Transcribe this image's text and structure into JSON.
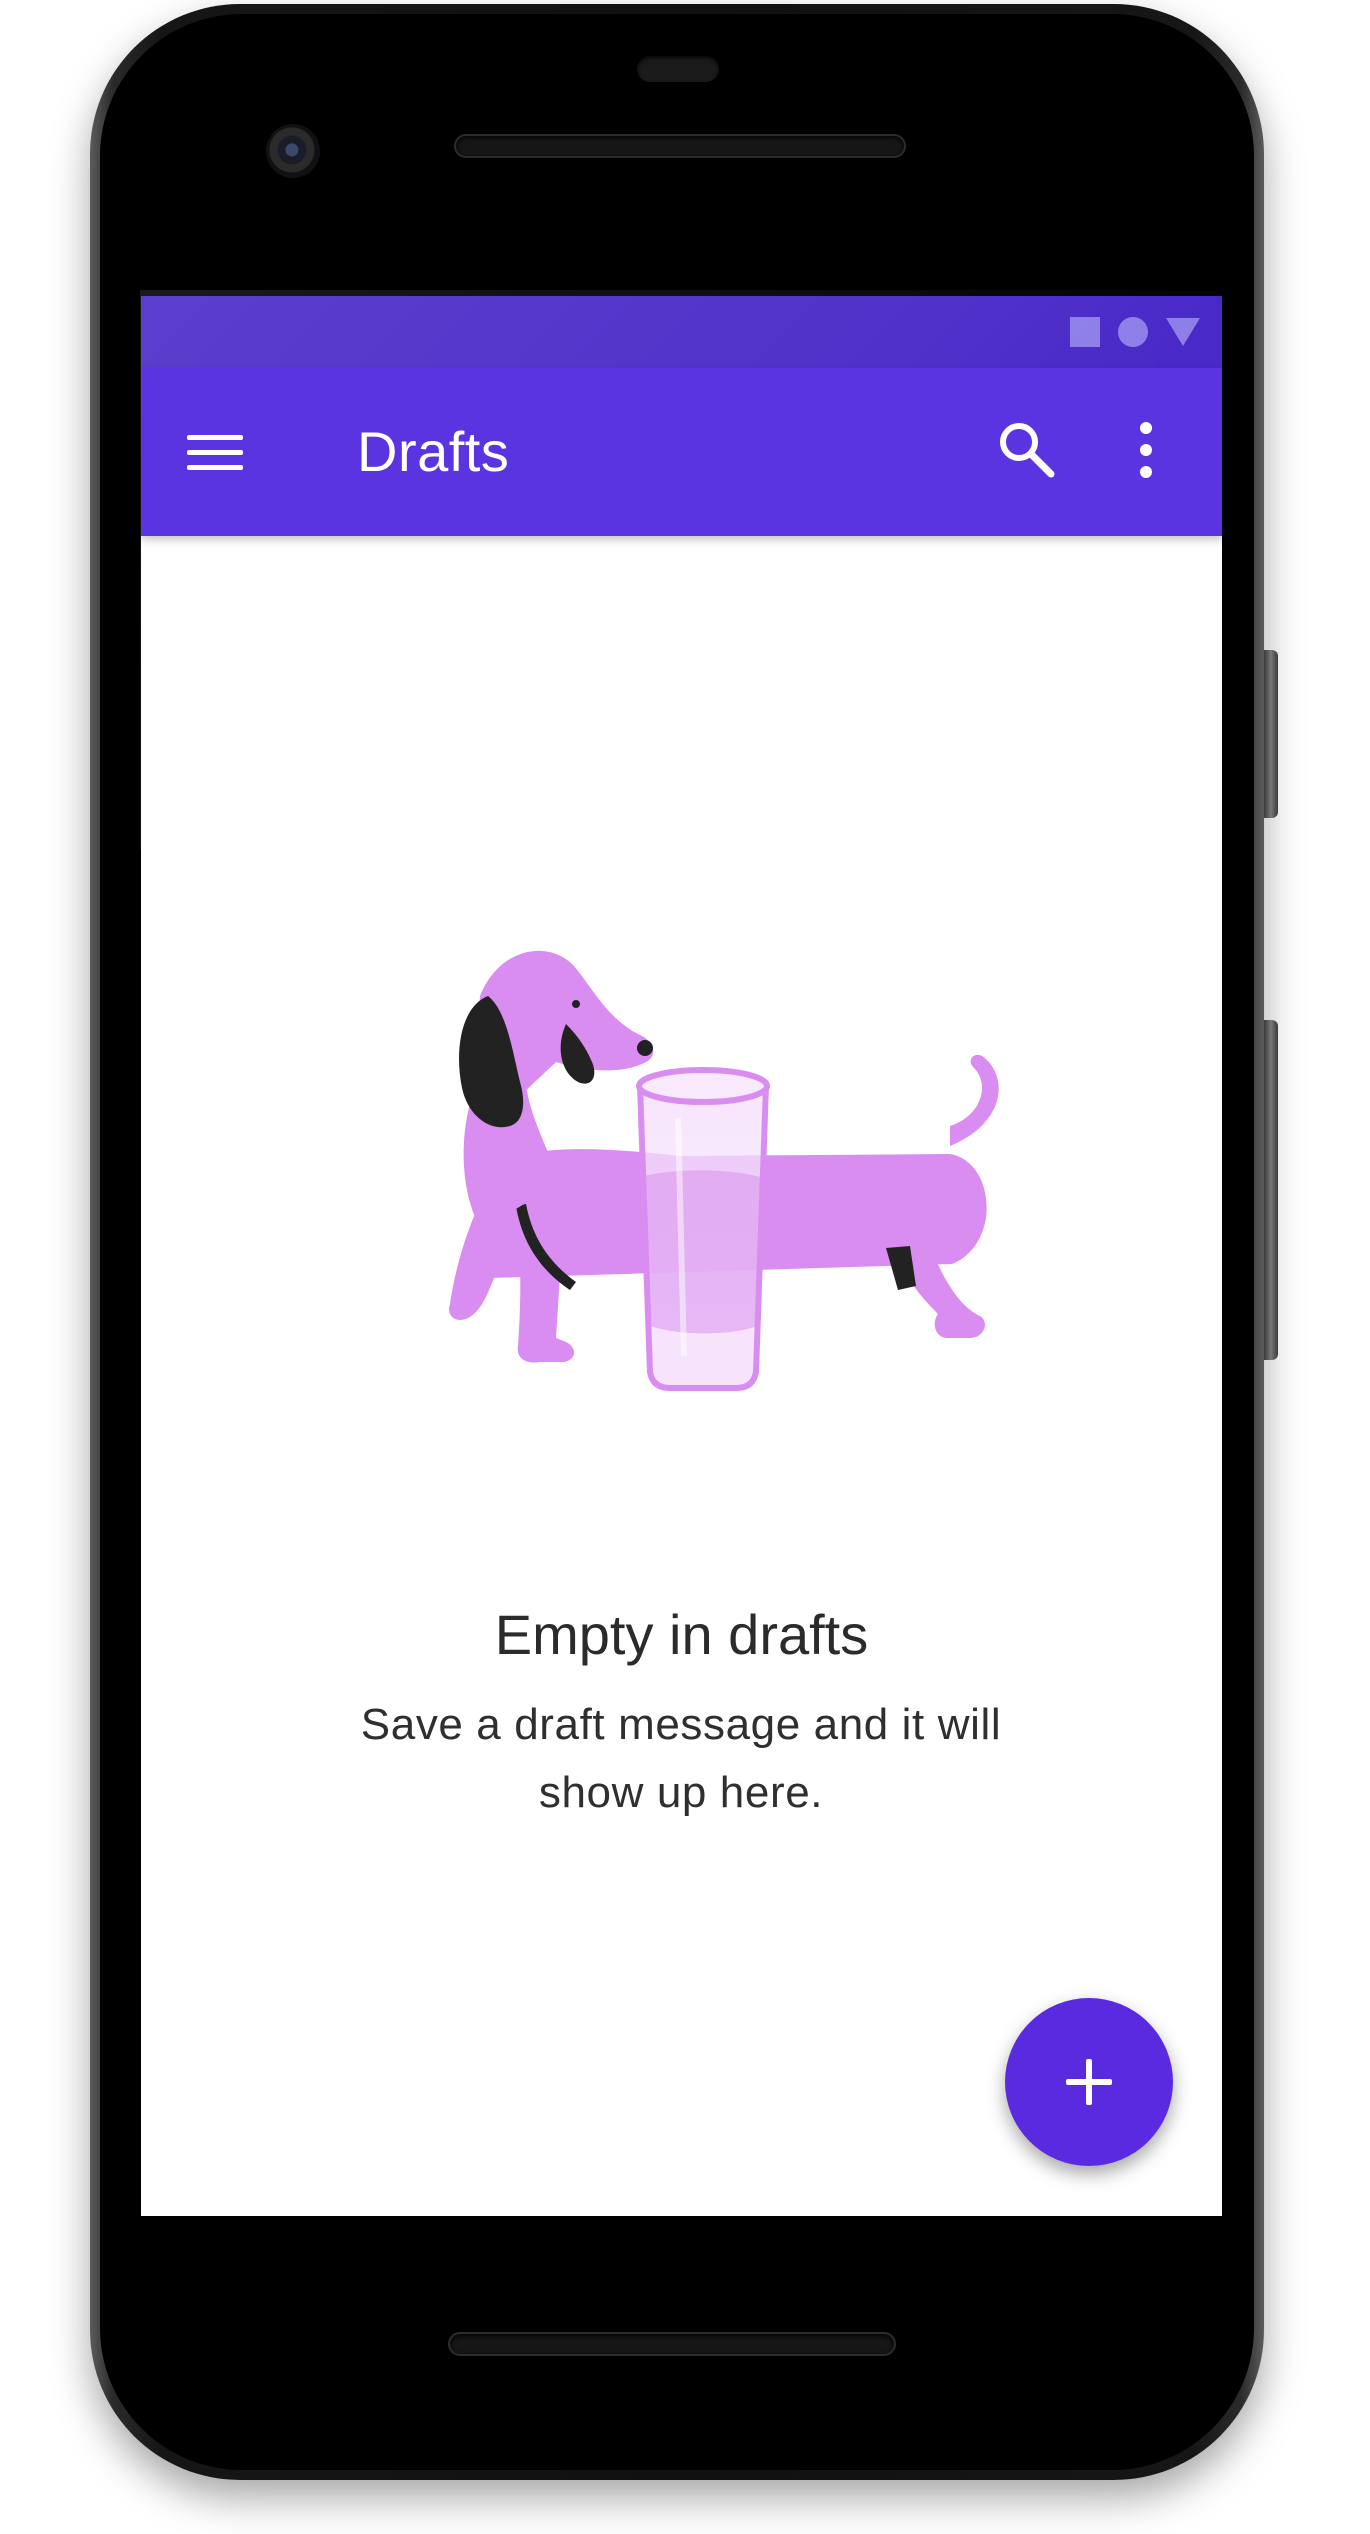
{
  "app_bar": {
    "title": "Drafts",
    "background_color": "#5a34e0",
    "status_bar_color": "#4929c8",
    "icons": [
      "menu-icon",
      "search-icon",
      "more-vert-icon"
    ]
  },
  "status_bar": {
    "icons": [
      "stop-icon",
      "circle-icon",
      "triangle-icon"
    ]
  },
  "empty_state": {
    "title": "Empty in drafts",
    "message": "Save a draft message and it will show up here.",
    "illustration": "dog-with-glass-illustration",
    "illustration_color": "#d98df0"
  },
  "fab": {
    "icon": "plus-icon",
    "color": "#5a2ae0"
  }
}
